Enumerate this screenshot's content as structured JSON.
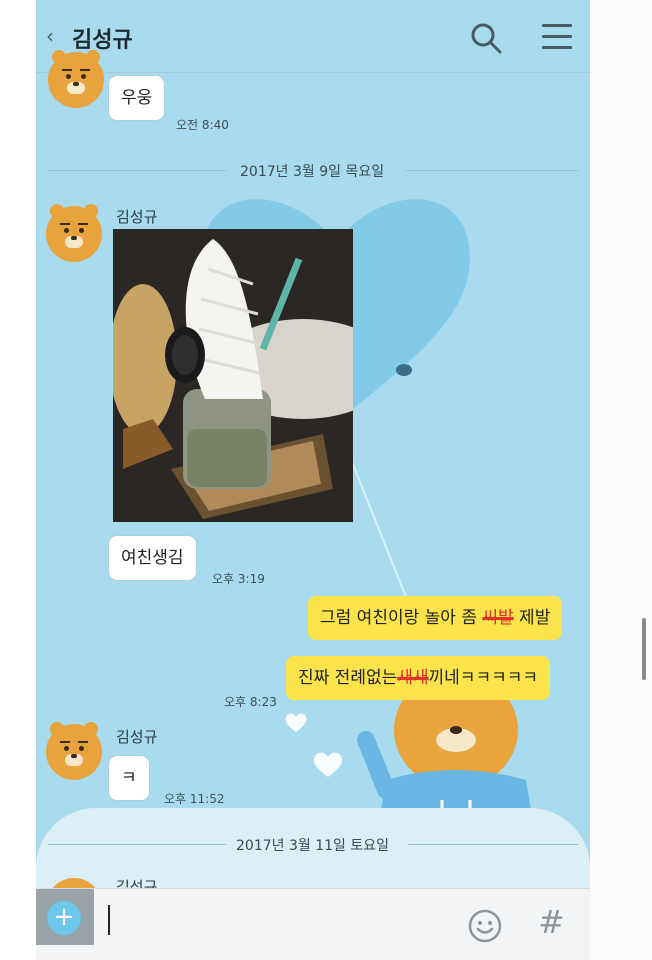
{
  "header": {
    "back_icon": "chevron-left-icon",
    "title": "김성규",
    "search_icon": "search-icon",
    "menu_icon": "hamburger-menu-icon"
  },
  "messages": {
    "m1": {
      "text": "우웅",
      "time": "오전 8:40"
    },
    "date1": "2017년 3월 9일 목요일",
    "sender": "김성규",
    "m2": {
      "text": "여친생김",
      "time": "오후 3:19"
    },
    "m3": {
      "parts": [
        "그럼 여친이랑 놀아 좀 ",
        "씨발",
        " 제발"
      ]
    },
    "m4": {
      "parts": [
        "진짜 전례없는",
        "새새",
        "끼네ㅋㅋㅋㅋㅋ"
      ],
      "time": "오후 8:23"
    },
    "m5": {
      "text": "ㅋ",
      "time": "오후 11:52"
    },
    "date2": "2017년 3월 11일 토요일",
    "sender_partial": "김성규"
  },
  "input_bar": {
    "plus_icon": "plus-icon",
    "plus": "+",
    "emoji_icon": "emoji-icon",
    "hash": "#",
    "hash_icon": "hashtag-icon"
  },
  "colors": {
    "background": "#a9dbee",
    "my_bubble": "#fbe44b",
    "their_bubble": "#ffffff",
    "accent": "#6cc7ea",
    "avatar": "#e8a33d"
  }
}
